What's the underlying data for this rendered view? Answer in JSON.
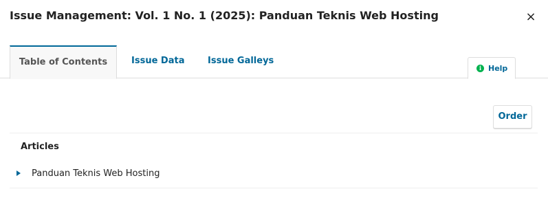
{
  "modal": {
    "title": "Issue Management: Vol. 1 No. 1 (2025): Panduan Teknis Web Hosting",
    "close_label": "×"
  },
  "tabs": [
    {
      "label": "Table of Contents",
      "active": true
    },
    {
      "label": "Issue Data",
      "active": false
    },
    {
      "label": "Issue Galleys",
      "active": false
    }
  ],
  "help": {
    "icon": "info-icon",
    "icon_glyph": "i",
    "label": "Help"
  },
  "toolbar": {
    "order_label": "Order"
  },
  "toc": {
    "section_title": "Articles",
    "articles": [
      {
        "title": "Panduan Teknis Web Hosting"
      }
    ]
  },
  "colors": {
    "accent": "#006798",
    "help_icon": "#00b24e",
    "text": "#222222"
  }
}
